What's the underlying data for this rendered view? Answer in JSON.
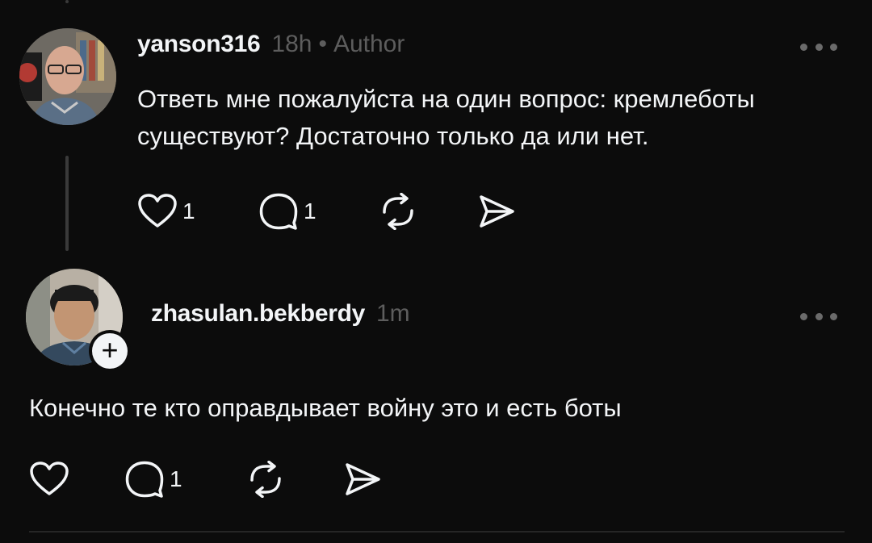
{
  "posts": [
    {
      "username": "yanson316",
      "time": "18h",
      "separator": "•",
      "role": "Author",
      "text_lines": [
        "Ответь мне пожалуйста на один вопрос: кремлеботы",
        "существуют? Достаточно только да или нет."
      ],
      "likes": "1",
      "replies": "1"
    },
    {
      "username": "zhasulan.bekberdy",
      "time": "1m",
      "text_lines": [
        "Конечно те кто оправдывает войну это и есть боты"
      ],
      "replies": "1",
      "follow_symbol": "+"
    }
  ],
  "icons": {
    "like": "heart-icon",
    "reply": "comment-icon",
    "repost": "repost-icon",
    "share": "send-icon",
    "more": "more-dots-icon"
  },
  "colors": {
    "background": "#0c0c0c",
    "text": "#f3f5f7",
    "secondary": "#5d5d5d"
  }
}
